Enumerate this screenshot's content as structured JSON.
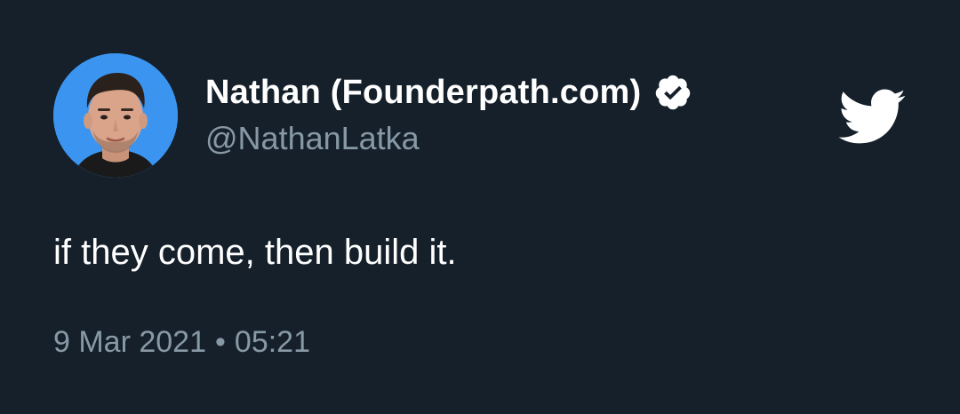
{
  "author": {
    "name": "Nathan (Founderpath.com)",
    "handle": "@NathanLatka",
    "verified": true
  },
  "tweet": {
    "text": "if they come, then build it.",
    "date": "9 Mar 2021",
    "separator": "•",
    "time": "05:21"
  },
  "icons": {
    "avatar": "profile-photo",
    "verified": "verified-badge-icon",
    "brand": "twitter-bird-icon"
  },
  "colors": {
    "background": "#15202b",
    "text_primary": "#ffffff",
    "text_secondary": "#8899a6",
    "avatar_background": "#3b95f0"
  }
}
